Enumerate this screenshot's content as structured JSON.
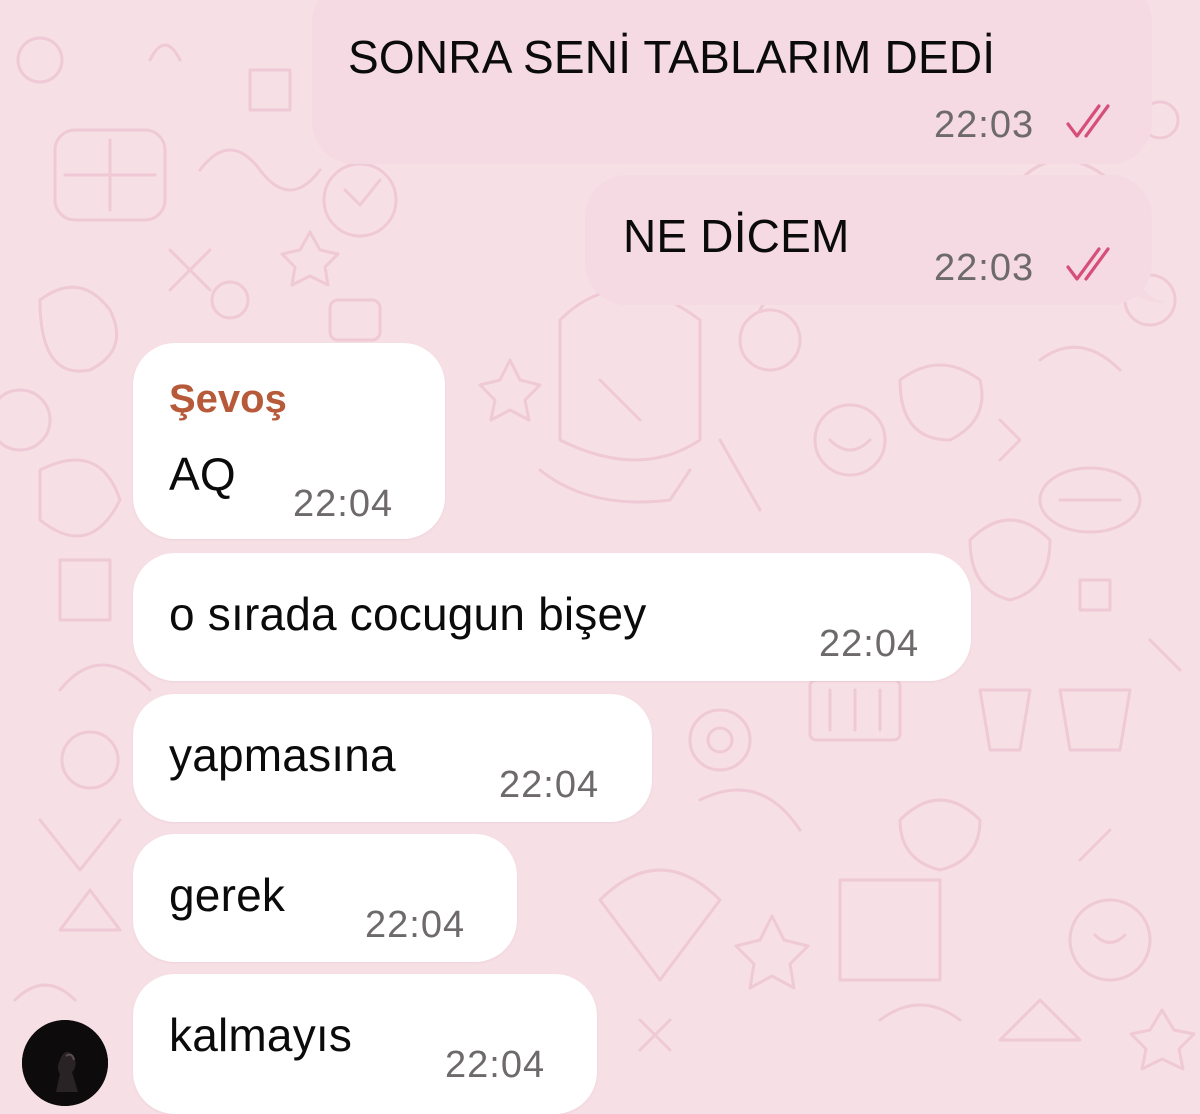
{
  "colors": {
    "background": "#f7dfe6",
    "outgoing_bubble": "#f5d9e3",
    "incoming_bubble": "#ffffff",
    "sender_name": "#b65a3a",
    "read_ticks": "#d64f7a",
    "timestamp": "#6e6a6c"
  },
  "messages": [
    {
      "direction": "outgoing",
      "text": "SONRA SENİ TABLARIM DEDİ",
      "time": "22:03",
      "status": "read-double-check-icon"
    },
    {
      "direction": "outgoing",
      "text": "NE DİCEM",
      "time": "22:03",
      "status": "read-double-check-icon"
    },
    {
      "direction": "incoming",
      "sender": "Şevoş",
      "text": "AQ",
      "time": "22:04"
    },
    {
      "direction": "incoming",
      "text": "o sırada cocugun bişey",
      "time": "22:04"
    },
    {
      "direction": "incoming",
      "text": "yapmasına",
      "time": "22:04"
    },
    {
      "direction": "incoming",
      "text": "gerek",
      "time": "22:04"
    },
    {
      "direction": "incoming",
      "text": "kalmayıs",
      "time": "22:04"
    }
  ],
  "avatar": {
    "icon": "user-avatar-photo"
  }
}
